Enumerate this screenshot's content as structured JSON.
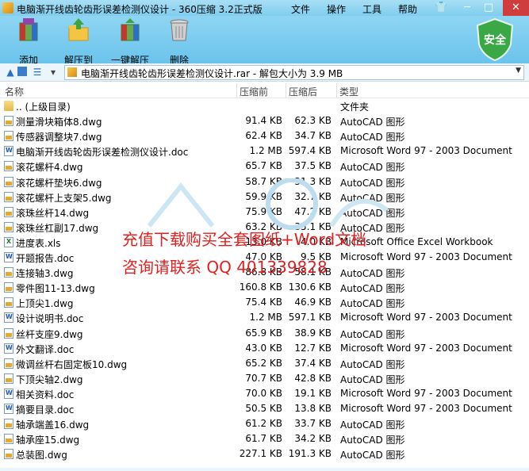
{
  "window": {
    "title": "电脑渐开线齿轮齿形误差检测仪设计 - 360压缩 3.2正式版",
    "menus": [
      "文件",
      "操作",
      "工具",
      "帮助"
    ],
    "controls": {
      "minimize": "─",
      "maximize": "□",
      "close": "✕"
    }
  },
  "toolbar": {
    "buttons": [
      {
        "label": "添加",
        "icon": "add-books-icon"
      },
      {
        "label": "解压到",
        "icon": "extract-folder-icon"
      },
      {
        "label": "一键解压",
        "icon": "one-click-extract-icon"
      },
      {
        "label": "删除",
        "icon": "trash-icon"
      }
    ],
    "security_badge": "安全"
  },
  "address": {
    "path": "电脑渐开线齿轮齿形误差检测仪设计.rar - 解包大小为 3.9 MB"
  },
  "columns": [
    "名称",
    "压缩前",
    "压缩后",
    "类型"
  ],
  "files": [
    {
      "name": ".. (上级目录)",
      "before": "",
      "after": "",
      "type": "文件夹",
      "icon": "folder"
    },
    {
      "name": "测量滑块箱体8.dwg",
      "before": "91.4 KB",
      "after": "62.3 KB",
      "type": "AutoCAD 图形",
      "icon": "dwg"
    },
    {
      "name": "传感器调整块7.dwg",
      "before": "62.4 KB",
      "after": "34.7 KB",
      "type": "AutoCAD 图形",
      "icon": "dwg"
    },
    {
      "name": "电脑渐开线齿轮齿形误差检测仪设计.doc",
      "before": "1.2 MB",
      "after": "597.4 KB",
      "type": "Microsoft Word 97 - 2003 Document",
      "icon": "doc"
    },
    {
      "name": "滚花螺杆4.dwg",
      "before": "65.7 KB",
      "after": "37.5 KB",
      "type": "AutoCAD 图形",
      "icon": "dwg"
    },
    {
      "name": "滚花螺杆垫块6.dwg",
      "before": "58.7 KB",
      "after": "31.3 KB",
      "type": "AutoCAD 图形",
      "icon": "dwg"
    },
    {
      "name": "滚花螺杆上支架5.dwg",
      "before": "59.9 KB",
      "after": "32.7 KB",
      "type": "AutoCAD 图形",
      "icon": "dwg"
    },
    {
      "name": "滚珠丝杆14.dwg",
      "before": "75.9 KB",
      "after": "47.2 KB",
      "type": "AutoCAD 图形",
      "icon": "dwg"
    },
    {
      "name": "滚珠丝杠副17.dwg",
      "before": "63.2 KB",
      "after": "35.1 KB",
      "type": "AutoCAD 图形",
      "icon": "dwg"
    },
    {
      "name": "进度表.xls",
      "before": "13.0 KB",
      "after": "4.0 KB",
      "type": "Microsoft Office Excel Workbook",
      "icon": "xls"
    },
    {
      "name": "开题报告.doc",
      "before": "47.0 KB",
      "after": "9.5 KB",
      "type": "Microsoft Word 97 - 2003 Document",
      "icon": "doc"
    },
    {
      "name": "连接轴3.dwg",
      "before": "86.8 KB",
      "after": "58.1 KB",
      "type": "AutoCAD 图形",
      "icon": "dwg"
    },
    {
      "name": "零件图11-13.dwg",
      "before": "160.8 KB",
      "after": "130.6 KB",
      "type": "AutoCAD 图形",
      "icon": "dwg"
    },
    {
      "name": "上顶尖1.dwg",
      "before": "75.4 KB",
      "after": "46.9 KB",
      "type": "AutoCAD 图形",
      "icon": "dwg"
    },
    {
      "name": "设计说明书.doc",
      "before": "1.2 MB",
      "after": "597.1 KB",
      "type": "Microsoft Word 97 - 2003 Document",
      "icon": "doc"
    },
    {
      "name": "丝杆支座9.dwg",
      "before": "65.9 KB",
      "after": "38.9 KB",
      "type": "AutoCAD 图形",
      "icon": "dwg"
    },
    {
      "name": "外文翻译.doc",
      "before": "43.0 KB",
      "after": "12.7 KB",
      "type": "Microsoft Word 97 - 2003 Document",
      "icon": "doc"
    },
    {
      "name": "微调丝杆右固定板10.dwg",
      "before": "65.2 KB",
      "after": "37.4 KB",
      "type": "AutoCAD 图形",
      "icon": "dwg"
    },
    {
      "name": "下顶尖轴2.dwg",
      "before": "70.7 KB",
      "after": "42.8 KB",
      "type": "AutoCAD 图形",
      "icon": "dwg"
    },
    {
      "name": "相关资料.doc",
      "before": "70.0 KB",
      "after": "19.1 KB",
      "type": "Microsoft Word 97 - 2003 Document",
      "icon": "doc"
    },
    {
      "name": "摘要目录.doc",
      "before": "50.5 KB",
      "after": "13.8 KB",
      "type": "Microsoft Word 97 - 2003 Document",
      "icon": "doc"
    },
    {
      "name": "轴承端盖16.dwg",
      "before": "61.2 KB",
      "after": "33.7 KB",
      "type": "AutoCAD 图形",
      "icon": "dwg"
    },
    {
      "name": "轴承座15.dwg",
      "before": "61.7 KB",
      "after": "34.2 KB",
      "type": "AutoCAD 图形",
      "icon": "dwg"
    },
    {
      "name": "总装图.dwg",
      "before": "227.1 KB",
      "after": "191.3 KB",
      "type": "AutoCAD 图形",
      "icon": "dwg"
    }
  ],
  "watermark": {
    "line1": "充值下载购买全套图纸+Word文档",
    "line2": "咨询请联系 QQ 401339828"
  }
}
